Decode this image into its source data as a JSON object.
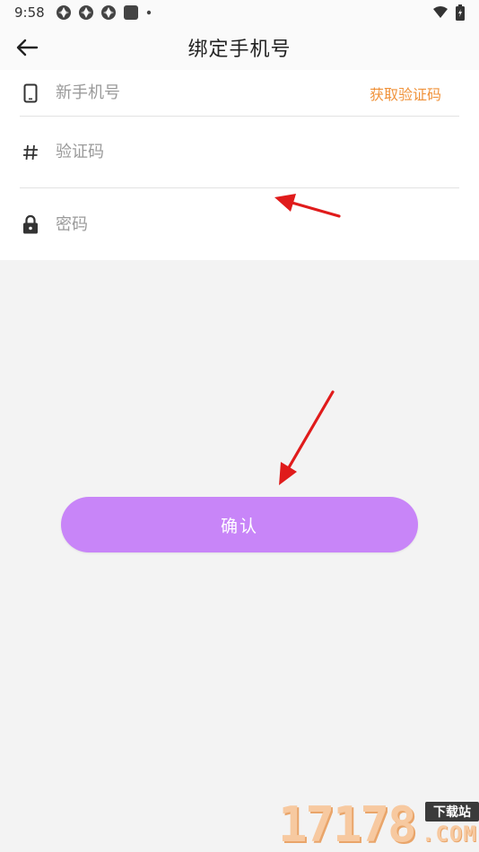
{
  "status_bar": {
    "time": "9:58",
    "notification_icons": [
      "aperture-icon",
      "aperture-icon",
      "aperture-icon",
      "square-icon",
      "dot-icon"
    ],
    "right_icons": [
      "wifi-icon",
      "battery-icon"
    ]
  },
  "header": {
    "title": "绑定手机号",
    "back_icon": "arrow-left-icon"
  },
  "form": {
    "phone": {
      "icon": "phone-icon",
      "placeholder": "新手机号",
      "value": ""
    },
    "get_code_label": "获取验证码",
    "code": {
      "icon": "hash-icon",
      "placeholder": "验证码",
      "value": ""
    },
    "password": {
      "icon": "lock-icon",
      "placeholder": "密码",
      "value": ""
    }
  },
  "confirm": {
    "label": "确认"
  },
  "watermark": {
    "digits": "17178",
    "tag": "下载站",
    "domain": ".COM"
  },
  "colors": {
    "accent_button": "#c885f8",
    "get_code_text": "#f0923a",
    "annotation_arrow": "#e01b1b",
    "background": "#f3f3f3"
  }
}
